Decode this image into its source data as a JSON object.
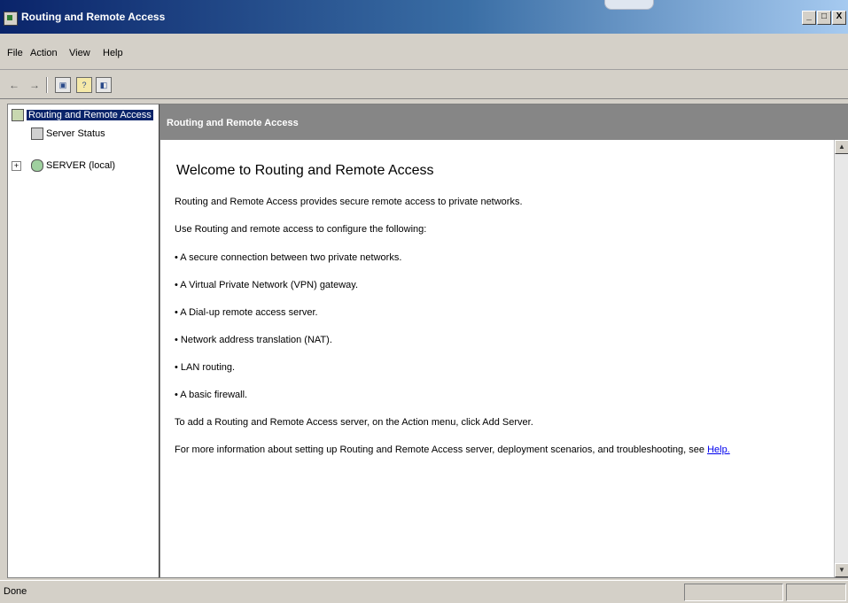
{
  "window": {
    "title": "Routing and Remote Access",
    "caption_buttons": [
      "_",
      "□",
      "X"
    ]
  },
  "menu": {
    "items": [
      "File",
      "Action",
      "View",
      "Help"
    ]
  },
  "toolbar": {
    "back": "←",
    "forward": "→",
    "buttons": [
      "show-hide-console-tree-icon",
      "help-icon",
      "show-hide-action-pane-icon"
    ]
  },
  "tree": {
    "root": "Routing and Remote Access",
    "items": [
      {
        "label": "Server Status",
        "icon": "server-status-icon"
      },
      {
        "label": "SERVER (local)",
        "icon": "server-icon",
        "expand": "+"
      }
    ]
  },
  "content": {
    "header": "Routing and Remote Access",
    "title": "Welcome to Routing and Remote Access",
    "intro": "Routing and Remote Access provides secure remote access to private networks.",
    "use_line": "Use Routing and remote access to configure the following:",
    "bullets": [
      "• A secure connection between two private networks.",
      "• A Virtual Private Network (VPN) gateway.",
      "• A Dial-up remote access server.",
      "• Network address translation (NAT).",
      "• LAN routing.",
      "• A basic firewall."
    ],
    "add_server": "To add a Routing and Remote Access server, on the Action menu, click Add Server.",
    "more_info": "For more information about setting up Routing and Remote Access server, deployment scenarios, and troubleshooting, see ",
    "help_link": "Help."
  },
  "status": {
    "text": "Done"
  }
}
